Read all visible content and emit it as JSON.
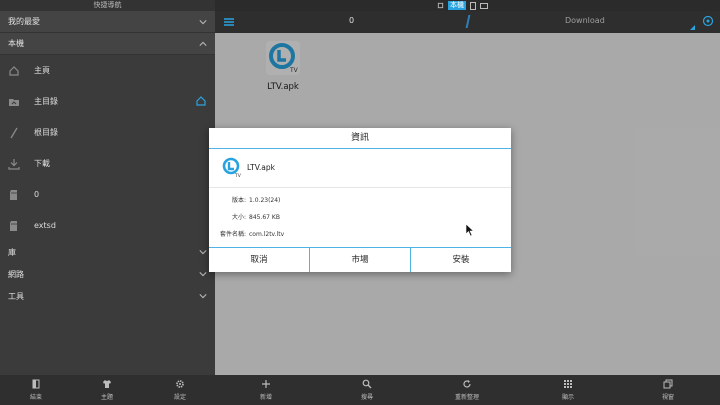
{
  "sidebar": {
    "title": "快捷導航",
    "sections": {
      "favorites": "我的最愛",
      "local": "本機",
      "library": "庫",
      "network": "網路",
      "tools": "工具"
    },
    "items": [
      {
        "label": "主頁",
        "icon": "home-icon"
      },
      {
        "label": "主目錄",
        "icon": "folder-home-icon"
      },
      {
        "label": "根目錄",
        "icon": "root-slash-icon"
      },
      {
        "label": "下載",
        "icon": "download-icon"
      },
      {
        "label": "0",
        "icon": "sd-card-icon"
      },
      {
        "label": "extsd",
        "icon": "sd-card-icon"
      }
    ]
  },
  "statusbar": {
    "local_label": "本機"
  },
  "pathbar": {
    "crumb_root": "0",
    "crumb_current": "Download"
  },
  "files": [
    {
      "name": "LTV.apk",
      "icon": "ltv-app-icon"
    }
  ],
  "dialog": {
    "title": "資訊",
    "app_name": "LTV.apk",
    "info": [
      {
        "key": "版本:",
        "value": "1.0.23(24)"
      },
      {
        "key": "大小:",
        "value": "845.67 KB"
      },
      {
        "key": "套件名稱:",
        "value": "com.l2tv.ltv"
      }
    ],
    "buttons": {
      "cancel": "取消",
      "market": "市場",
      "install": "安裝"
    }
  },
  "bottom_bar": {
    "items": [
      {
        "label": "結束",
        "icon": "exit-icon"
      },
      {
        "label": "主題",
        "icon": "shirt-icon"
      },
      {
        "label": "設定",
        "icon": "gear-icon"
      },
      {
        "label": "新增",
        "icon": "plus-icon"
      },
      {
        "label": "搜尋",
        "icon": "search-icon"
      },
      {
        "label": "重新整理",
        "icon": "refresh-icon"
      },
      {
        "label": "顯示",
        "icon": "grid-icon"
      },
      {
        "label": "視窗",
        "icon": "windows-icon"
      }
    ]
  },
  "colors": {
    "accent": "#29a3e0",
    "sidebar_bg": "#3b3b3b",
    "content_bg": "#ebebeb"
  }
}
